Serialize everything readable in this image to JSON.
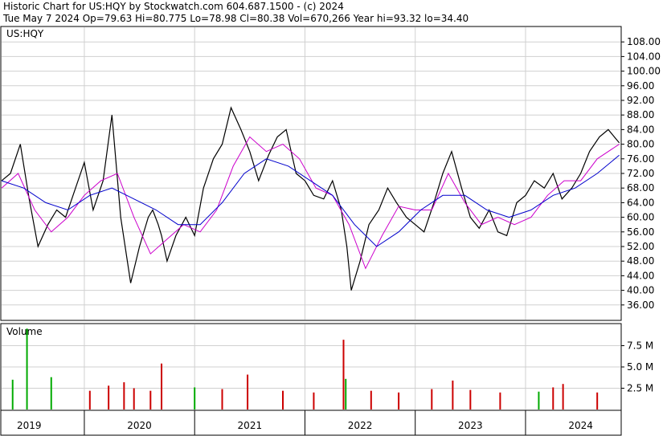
{
  "header": {
    "line1": "Historic Chart for US:HQY by Stockwatch.com 604.687.1500 - (c) 2024",
    "line2": "Tue May  7 2024  Op=79.63  Hi=80.775  Lo=78.98  Cl=80.38  Vol=670,266  Year hi=93.32  lo=34.40"
  },
  "chart_data": {
    "type": "line",
    "symbol": "US:HQY",
    "price_panel": {
      "ylim": [
        32,
        112
      ],
      "y_ticks": [
        "108.00",
        "104.00",
        "100.00",
        "96.00",
        "92.00",
        "88.00",
        "84.00",
        "80.00",
        "76.00",
        "72.00",
        "68.00",
        "64.00",
        "60.00",
        "56.00",
        "52.00",
        "48.00",
        "44.00",
        "40.00",
        "36.00"
      ],
      "grid": true,
      "x_range": [
        2018.75,
        2024.36
      ],
      "series": [
        {
          "color": "#000000",
          "x": [
            2018.75,
            2018.83,
            2018.92,
            2019.0,
            2019.08,
            2019.17,
            2019.25,
            2019.33,
            2019.42,
            2019.5,
            2019.58,
            2019.67,
            2019.75,
            2019.83,
            2019.92,
            2020.0,
            2020.08,
            2020.12,
            2020.17,
            2020.2,
            2020.25,
            2020.33,
            2020.42,
            2020.5,
            2020.58,
            2020.67,
            2020.75,
            2020.83,
            2020.92,
            2021.0,
            2021.08,
            2021.17,
            2021.25,
            2021.33,
            2021.42,
            2021.5,
            2021.58,
            2021.67,
            2021.75,
            2021.83,
            2021.88,
            2021.92,
            2022.0,
            2022.08,
            2022.17,
            2022.25,
            2022.33,
            2022.42,
            2022.5,
            2022.58,
            2022.67,
            2022.75,
            2022.83,
            2022.92,
            2023.0,
            2023.08,
            2023.17,
            2023.25,
            2023.33,
            2023.42,
            2023.5,
            2023.58,
            2023.67,
            2023.75,
            2023.83,
            2023.92,
            2024.0,
            2024.08,
            2024.17,
            2024.25,
            2024.35
          ],
          "y": [
            70,
            72,
            80,
            65,
            52,
            58,
            62,
            60,
            68,
            75,
            62,
            70,
            88,
            60,
            42,
            52,
            60,
            62,
            58,
            55,
            48,
            55,
            60,
            55,
            68,
            76,
            80,
            90,
            84,
            78,
            70,
            77,
            82,
            84,
            72,
            70,
            66,
            65,
            70,
            62,
            52,
            40,
            48,
            58,
            62,
            68,
            64,
            60,
            58,
            56,
            64,
            72,
            78,
            68,
            60,
            57,
            62,
            56,
            55,
            64,
            66,
            70,
            68,
            72,
            65,
            68,
            72,
            78,
            82,
            84,
            80.38
          ]
        },
        {
          "color": "#cc00cc",
          "x": [
            2018.75,
            2018.9,
            2019.05,
            2019.2,
            2019.35,
            2019.5,
            2019.65,
            2019.8,
            2019.95,
            2020.1,
            2020.25,
            2020.4,
            2020.55,
            2020.7,
            2020.85,
            2021.0,
            2021.15,
            2021.3,
            2021.45,
            2021.6,
            2021.75,
            2021.9,
            2022.05,
            2022.2,
            2022.35,
            2022.5,
            2022.65,
            2022.8,
            2022.95,
            2023.1,
            2023.25,
            2023.4,
            2023.55,
            2023.7,
            2023.85,
            2024.0,
            2024.15,
            2024.35
          ],
          "y": [
            68,
            72,
            62,
            56,
            60,
            66,
            70,
            72,
            60,
            50,
            54,
            58,
            56,
            62,
            74,
            82,
            78,
            80,
            76,
            68,
            66,
            58,
            46,
            55,
            63,
            62,
            62,
            72,
            64,
            58,
            60,
            58,
            60,
            66,
            70,
            70,
            76,
            80
          ]
        },
        {
          "color": "#0000cc",
          "x": [
            2018.75,
            2018.95,
            2019.15,
            2019.35,
            2019.55,
            2019.75,
            2019.95,
            2020.15,
            2020.35,
            2020.55,
            2020.75,
            2020.95,
            2021.15,
            2021.35,
            2021.55,
            2021.75,
            2021.95,
            2022.15,
            2022.35,
            2022.55,
            2022.75,
            2022.95,
            2023.15,
            2023.35,
            2023.55,
            2023.75,
            2023.95,
            2024.15,
            2024.35
          ],
          "y": [
            70,
            68,
            64,
            62,
            66,
            68,
            65,
            62,
            58,
            58,
            64,
            72,
            76,
            74,
            70,
            66,
            58,
            52,
            56,
            62,
            66,
            66,
            62,
            60,
            62,
            66,
            68,
            72,
            77
          ]
        }
      ]
    },
    "volume_panel": {
      "label": "Volume",
      "ylim": [
        0,
        10
      ],
      "y_ticks": [
        "7.5 M",
        "5.0 M",
        "2.5 M"
      ],
      "tick_values": [
        7.5,
        5.0,
        2.5
      ],
      "spikes": [
        {
          "x": 2018.85,
          "v": 3.5,
          "color": "#00aa00"
        },
        {
          "x": 2018.98,
          "v": 9.5,
          "color": "#00aa00"
        },
        {
          "x": 2019.2,
          "v": 3.8,
          "color": "#00aa00"
        },
        {
          "x": 2019.55,
          "v": 2.2,
          "color": "#cc0000"
        },
        {
          "x": 2019.72,
          "v": 2.8,
          "color": "#cc0000"
        },
        {
          "x": 2019.86,
          "v": 3.2,
          "color": "#cc0000"
        },
        {
          "x": 2019.95,
          "v": 2.5,
          "color": "#cc0000"
        },
        {
          "x": 2020.1,
          "v": 2.2,
          "color": "#cc0000"
        },
        {
          "x": 2020.2,
          "v": 5.4,
          "color": "#cc0000"
        },
        {
          "x": 2020.5,
          "v": 2.6,
          "color": "#00aa00"
        },
        {
          "x": 2020.75,
          "v": 2.4,
          "color": "#cc0000"
        },
        {
          "x": 2020.98,
          "v": 4.1,
          "color": "#cc0000"
        },
        {
          "x": 2021.3,
          "v": 2.2,
          "color": "#cc0000"
        },
        {
          "x": 2021.58,
          "v": 2.0,
          "color": "#cc0000"
        },
        {
          "x": 2021.85,
          "v": 8.2,
          "color": "#cc0000"
        },
        {
          "x": 2021.87,
          "v": 3.6,
          "color": "#00aa00"
        },
        {
          "x": 2022.1,
          "v": 2.2,
          "color": "#cc0000"
        },
        {
          "x": 2022.35,
          "v": 2.0,
          "color": "#cc0000"
        },
        {
          "x": 2022.65,
          "v": 2.4,
          "color": "#cc0000"
        },
        {
          "x": 2022.84,
          "v": 3.4,
          "color": "#cc0000"
        },
        {
          "x": 2023.0,
          "v": 2.3,
          "color": "#cc0000"
        },
        {
          "x": 2023.27,
          "v": 2.0,
          "color": "#cc0000"
        },
        {
          "x": 2023.62,
          "v": 2.1,
          "color": "#00aa00"
        },
        {
          "x": 2023.75,
          "v": 2.6,
          "color": "#cc0000"
        },
        {
          "x": 2023.84,
          "v": 3.0,
          "color": "#cc0000"
        },
        {
          "x": 2024.15,
          "v": 2.0,
          "color": "#cc0000"
        }
      ]
    },
    "x_ticks": [
      {
        "label": "2019",
        "x": 2019.0
      },
      {
        "label": "2020",
        "x": 2020.0
      },
      {
        "label": "2021",
        "x": 2021.0
      },
      {
        "label": "2022",
        "x": 2022.0
      },
      {
        "label": "2023",
        "x": 2023.0
      },
      {
        "label": "2024",
        "x": 2024.0
      }
    ],
    "x_dividers": [
      2019.5,
      2020.5,
      2021.5,
      2022.5,
      2023.5
    ]
  }
}
